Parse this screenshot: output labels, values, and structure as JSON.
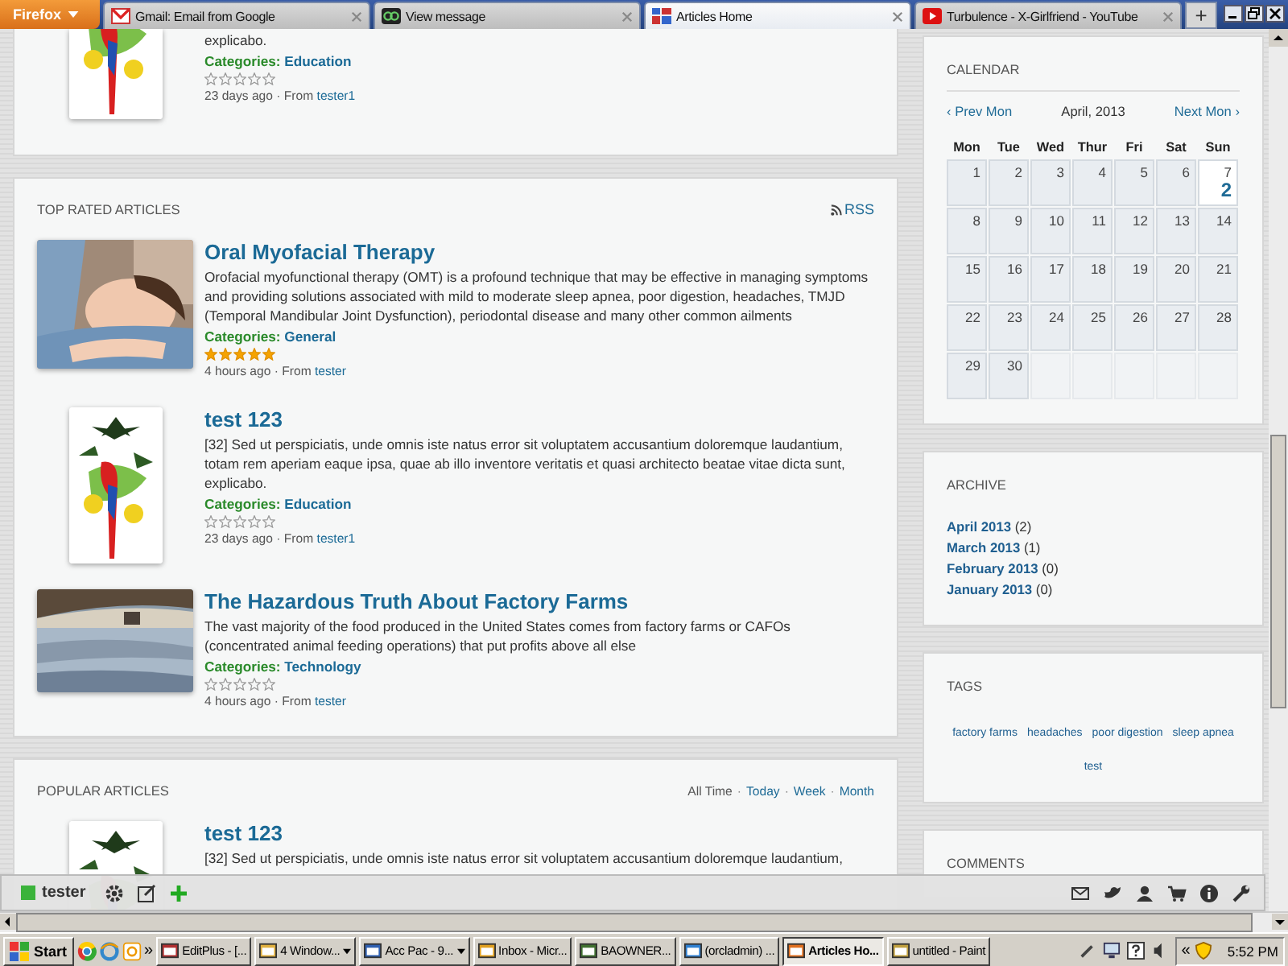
{
  "browser": {
    "menu_button": "Firefox",
    "tabs": [
      {
        "title": "Gmail: Email from Google",
        "selected": false
      },
      {
        "title": "View message",
        "selected": false
      },
      {
        "title": "Articles Home",
        "selected": true
      },
      {
        "title": "Turbulence - X-Girlfriend - YouTube",
        "selected": false
      }
    ],
    "new_tab": "+"
  },
  "previous_article": {
    "excerpt": "explicabo.",
    "category_label": "Categories:",
    "category": "Education",
    "stars": 0,
    "age": "23 days ago",
    "from_label": "· From",
    "author": "tester1"
  },
  "top_rated": {
    "title": "TOP RATED ARTICLES",
    "rss": "RSS",
    "articles": [
      {
        "title": "Oral Myofacial Therapy",
        "excerpt": "Orofacial myofunctional therapy (OMT) is a profound technique that may be effective in managing symptoms and providing solutions associated with mild to moderate sleep apnea, poor digestion, headaches, TMJD (Temporal Mandibular Joint Dysfunction), periodontal disease and many other common ailments",
        "category_label": "Categories:",
        "category": "General",
        "stars": 5,
        "age": "4 hours ago",
        "from_label": "· From",
        "author": "tester"
      },
      {
        "title": "test 123",
        "excerpt": "[32] Sed ut perspiciatis, unde omnis iste natus error sit voluptatem accusantium doloremque laudantium, totam rem aperiam eaque ipsa, quae ab illo inventore veritatis et quasi architecto beatae vitae dicta sunt, explicabo.",
        "category_label": "Categories:",
        "category": "Education",
        "stars": 0,
        "age": "23 days ago",
        "from_label": "· From",
        "author": "tester1"
      },
      {
        "title": "The Hazardous Truth About Factory Farms",
        "excerpt": "The vast majority of the food produced in the United States comes from factory farms or CAFOs (concentrated animal feeding operations) that put profits above all else",
        "category_label": "Categories:",
        "category": "Technology",
        "stars": 0,
        "age": "4 hours ago",
        "from_label": "· From",
        "author": "tester"
      }
    ]
  },
  "popular": {
    "title": "POPULAR ARTICLES",
    "separator": "·",
    "filters": [
      {
        "label": "All Time",
        "selected": true
      },
      {
        "label": "Today",
        "selected": false
      },
      {
        "label": "Week",
        "selected": false
      },
      {
        "label": "Month",
        "selected": false
      }
    ],
    "articles": [
      {
        "title": "test 123",
        "excerpt": "[32] Sed ut perspiciatis, unde omnis iste natus error sit voluptatem accusantium doloremque laudantium,"
      }
    ]
  },
  "calendar": {
    "title": "CALENDAR",
    "prev": "‹ Prev Mon",
    "month": "April, 2013",
    "next": "Next Mon ›",
    "weekdays": [
      "Mon",
      "Tue",
      "Wed",
      "Thur",
      "Fri",
      "Sat",
      "Sun"
    ],
    "weeks": [
      [
        {
          "day": "1",
          "today": false
        },
        {
          "day": "2",
          "today": false
        },
        {
          "day": "3",
          "today": false
        },
        {
          "day": "4",
          "today": false
        },
        {
          "day": "5",
          "today": false
        },
        {
          "day": "6",
          "today": false
        },
        {
          "day": "7",
          "today": true,
          "count": "2"
        }
      ],
      [
        {
          "day": "8",
          "today": false
        },
        {
          "day": "9",
          "today": false
        },
        {
          "day": "10",
          "today": false
        },
        {
          "day": "11",
          "today": false
        },
        {
          "day": "12",
          "today": false
        },
        {
          "day": "13",
          "today": false
        },
        {
          "day": "14",
          "today": false
        }
      ],
      [
        {
          "day": "15",
          "today": false
        },
        {
          "day": "16",
          "today": false
        },
        {
          "day": "17",
          "today": false
        },
        {
          "day": "18",
          "today": false
        },
        {
          "day": "19",
          "today": false
        },
        {
          "day": "20",
          "today": false
        },
        {
          "day": "21",
          "today": false
        }
      ],
      [
        {
          "day": "22",
          "today": false
        },
        {
          "day": "23",
          "today": false
        },
        {
          "day": "24",
          "today": false
        },
        {
          "day": "25",
          "today": false
        },
        {
          "day": "26",
          "today": false
        },
        {
          "day": "27",
          "today": false
        },
        {
          "day": "28",
          "today": false
        }
      ],
      [
        {
          "day": "29",
          "today": false
        },
        {
          "day": "30",
          "today": false
        }
      ]
    ]
  },
  "archive": {
    "title": "ARCHIVE",
    "items": [
      {
        "label": "April 2013",
        "count": "(2)"
      },
      {
        "label": "March 2013",
        "count": "(1)"
      },
      {
        "label": "February 2013",
        "count": "(0)"
      },
      {
        "label": "January 2013",
        "count": "(0)"
      }
    ]
  },
  "tags": {
    "title": "TAGS",
    "items": [
      "factory farms",
      "headaches",
      "poor digestion",
      "sleep apnea",
      "test"
    ]
  },
  "comments": {
    "title": "COMMENTS"
  },
  "user_bar": {
    "user": "tester"
  },
  "taskbar": {
    "start": "Start",
    "more": "»",
    "tasks": [
      {
        "label": "EditPlus - [...",
        "selected": false,
        "grouped": false
      },
      {
        "label": "4 Window...",
        "selected": false,
        "grouped": true
      },
      {
        "label": "Acc Pac - 9...",
        "selected": false,
        "grouped": true
      },
      {
        "label": "Inbox - Micr...",
        "selected": false,
        "grouped": false
      },
      {
        "label": "BAOWNER...",
        "selected": false,
        "grouped": false
      },
      {
        "label": "(orcladmin) ...",
        "selected": false,
        "grouped": false
      },
      {
        "label": "Articles Ho...",
        "selected": true,
        "grouped": false
      },
      {
        "label": "untitled - Paint",
        "selected": false,
        "grouped": false
      }
    ],
    "tray_more": "«",
    "clock": "5:52 PM"
  }
}
